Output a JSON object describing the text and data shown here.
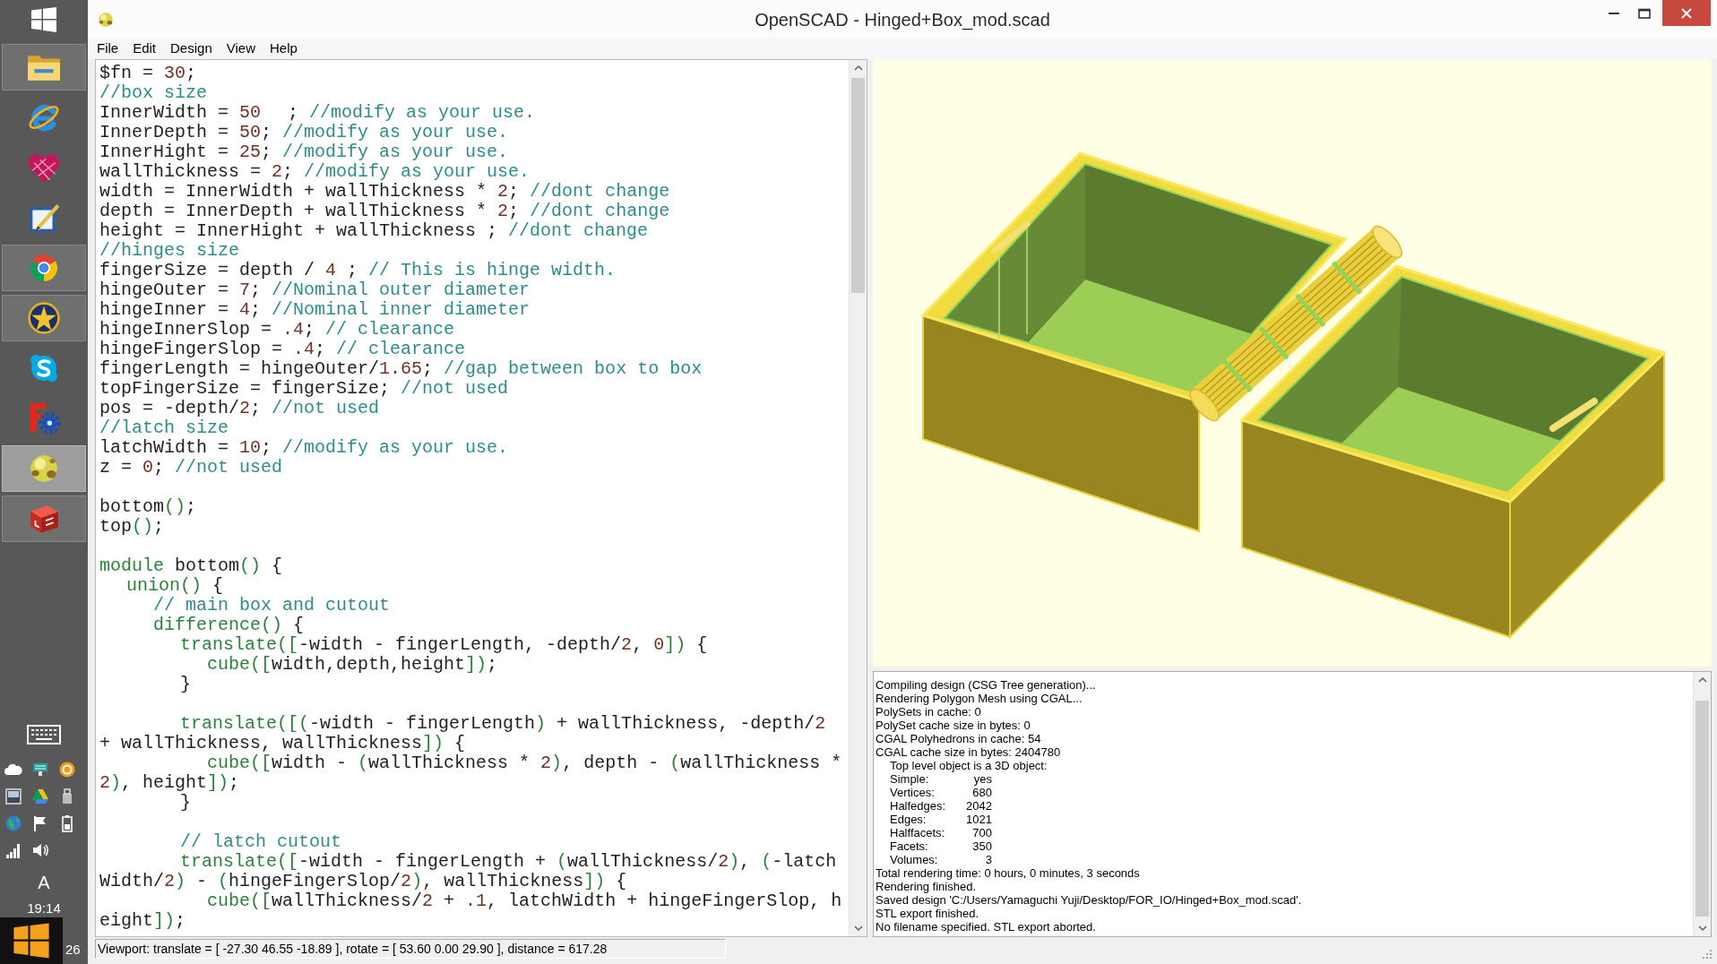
{
  "window": {
    "title": "OpenSCAD - Hinged+Box_mod.scad"
  },
  "menu": [
    "File",
    "Edit",
    "Design",
    "View",
    "Help"
  ],
  "editor": {
    "paragraphs": [
      {
        "lines": [
          {
            "tokens": [
              {
                "kind": "plain",
                "text": "$fn = "
              },
              {
                "kind": "number",
                "text": "30"
              },
              {
                "kind": "plain",
                "text": ";"
              }
            ]
          },
          {
            "tokens": [
              {
                "kind": "comment",
                "text": "//box size"
              }
            ]
          },
          {
            "tokens": [
              {
                "kind": "plain",
                "text": "InnerWidth = "
              },
              {
                "kind": "number",
                "text": "50"
              },
              {
                "kind": "plain",
                "text": "\t; "
              },
              {
                "kind": "comment",
                "text": "//modify as your use."
              }
            ]
          },
          {
            "tokens": [
              {
                "kind": "plain",
                "text": "InnerDepth = "
              },
              {
                "kind": "number",
                "text": "50"
              },
              {
                "kind": "plain",
                "text": "; "
              },
              {
                "kind": "comment",
                "text": "//modify as your use."
              }
            ]
          },
          {
            "tokens": [
              {
                "kind": "plain",
                "text": "InnerHight = "
              },
              {
                "kind": "number",
                "text": "25"
              },
              {
                "kind": "plain",
                "text": "; "
              },
              {
                "kind": "comment",
                "text": "//modify as your use."
              }
            ]
          },
          {
            "tokens": [
              {
                "kind": "plain",
                "text": "wallThickness = "
              },
              {
                "kind": "number",
                "text": "2"
              },
              {
                "kind": "plain",
                "text": "; "
              },
              {
                "kind": "comment",
                "text": "//modify as your use."
              }
            ]
          },
          {
            "tokens": [
              {
                "kind": "plain",
                "text": "width = InnerWidth + wallThickness * "
              },
              {
                "kind": "number",
                "text": "2"
              },
              {
                "kind": "plain",
                "text": "; "
              },
              {
                "kind": "comment",
                "text": "//dont change"
              }
            ]
          },
          {
            "tokens": [
              {
                "kind": "plain",
                "text": "depth = InnerDepth + wallThickness * "
              },
              {
                "kind": "number",
                "text": "2"
              },
              {
                "kind": "plain",
                "text": "; "
              },
              {
                "kind": "comment",
                "text": "//dont change"
              }
            ]
          },
          {
            "tokens": [
              {
                "kind": "plain",
                "text": "height = InnerHight + wallThickness ; "
              },
              {
                "kind": "comment",
                "text": "//dont change"
              }
            ]
          },
          {
            "tokens": [
              {
                "kind": "comment",
                "text": "//hinges size"
              }
            ]
          },
          {
            "tokens": [
              {
                "kind": "plain",
                "text": "fingerSize = depth / "
              },
              {
                "kind": "number",
                "text": "4"
              },
              {
                "kind": "plain",
                "text": " ; "
              },
              {
                "kind": "comment",
                "text": "// This is hinge width."
              }
            ]
          },
          {
            "tokens": [
              {
                "kind": "plain",
                "text": "hingeOuter = "
              },
              {
                "kind": "number",
                "text": "7"
              },
              {
                "kind": "plain",
                "text": "; "
              },
              {
                "kind": "comment",
                "text": "//Nominal outer diameter"
              }
            ]
          },
          {
            "tokens": [
              {
                "kind": "plain",
                "text": "hingeInner = "
              },
              {
                "kind": "number",
                "text": "4"
              },
              {
                "kind": "plain",
                "text": "; "
              },
              {
                "kind": "comment",
                "text": "//Nominal inner diameter"
              }
            ]
          },
          {
            "tokens": [
              {
                "kind": "plain",
                "text": "hingeInnerSlop = "
              },
              {
                "kind": "number",
                "text": ".4"
              },
              {
                "kind": "plain",
                "text": "; "
              },
              {
                "kind": "comment",
                "text": "// clearance"
              }
            ]
          },
          {
            "tokens": [
              {
                "kind": "plain",
                "text": "hingeFingerSlop = "
              },
              {
                "kind": "number",
                "text": ".4"
              },
              {
                "kind": "plain",
                "text": "; "
              },
              {
                "kind": "comment",
                "text": "// clearance"
              }
            ]
          },
          {
            "tokens": [
              {
                "kind": "plain",
                "text": "fingerLength = hingeOuter/"
              },
              {
                "kind": "number",
                "text": "1.65"
              },
              {
                "kind": "plain",
                "text": "; "
              },
              {
                "kind": "comment",
                "text": "//gap between box to box"
              }
            ]
          },
          {
            "tokens": [
              {
                "kind": "plain",
                "text": "topFingerSize = fingerSize; "
              },
              {
                "kind": "comment",
                "text": "//not used"
              }
            ]
          },
          {
            "tokens": [
              {
                "kind": "plain",
                "text": "pos = -depth/"
              },
              {
                "kind": "number",
                "text": "2"
              },
              {
                "kind": "plain",
                "text": "; "
              },
              {
                "kind": "comment",
                "text": "//not used"
              }
            ]
          },
          {
            "tokens": [
              {
                "kind": "comment",
                "text": "//latch size"
              }
            ]
          },
          {
            "tokens": [
              {
                "kind": "plain",
                "text": "latchWidth = "
              },
              {
                "kind": "number",
                "text": "10"
              },
              {
                "kind": "plain",
                "text": "; "
              },
              {
                "kind": "comment",
                "text": "//modify as your use."
              }
            ]
          },
          {
            "tokens": [
              {
                "kind": "plain",
                "text": "z = "
              },
              {
                "kind": "number",
                "text": "0"
              },
              {
                "kind": "plain",
                "text": "; "
              },
              {
                "kind": "comment",
                "text": "//not used"
              }
            ]
          }
        ]
      },
      {
        "lines": [
          {
            "tokens": [
              {
                "kind": "plain",
                "text": "bottom"
              },
              {
                "kind": "bracket",
                "text": "()"
              },
              {
                "kind": "plain",
                "text": ";"
              }
            ]
          },
          {
            "tokens": [
              {
                "kind": "plain",
                "text": "top"
              },
              {
                "kind": "bracket",
                "text": "()"
              },
              {
                "kind": "plain",
                "text": ";"
              }
            ]
          }
        ]
      },
      {
        "lines": [
          {
            "tokens": [
              {
                "kind": "keyword",
                "text": "module"
              },
              {
                "kind": "plain",
                "text": " bottom"
              },
              {
                "kind": "bracket",
                "text": "()"
              },
              {
                "kind": "plain",
                "text": " {"
              }
            ]
          },
          {
            "tokens": [
              {
                "kind": "keyword",
                "text": "\tunion"
              },
              {
                "kind": "bracket",
                "text": "()"
              },
              {
                "kind": "plain",
                "text": " {"
              }
            ]
          },
          {
            "tokens": [
              {
                "kind": "comment",
                "text": "\t\t// main box and cutout"
              }
            ]
          },
          {
            "tokens": [
              {
                "kind": "keyword",
                "text": "\t\tdifference"
              },
              {
                "kind": "bracket",
                "text": "()"
              },
              {
                "kind": "plain",
                "text": " {"
              }
            ]
          },
          {
            "tokens": [
              {
                "kind": "keyword",
                "text": "\t\t\ttranslate"
              },
              {
                "kind": "bracket",
                "text": "(["
              },
              {
                "kind": "plain",
                "text": "-width - fingerLength, -depth/"
              },
              {
                "kind": "number",
                "text": "2"
              },
              {
                "kind": "plain",
                "text": ", "
              },
              {
                "kind": "number",
                "text": "0"
              },
              {
                "kind": "bracket",
                "text": "])"
              },
              {
                "kind": "plain",
                "text": " {"
              }
            ]
          },
          {
            "tokens": [
              {
                "kind": "keyword",
                "text": "\t\t\t\tcube"
              },
              {
                "kind": "bracket",
                "text": "(["
              },
              {
                "kind": "plain",
                "text": "width,depth,height"
              },
              {
                "kind": "bracket",
                "text": "])"
              },
              {
                "kind": "plain",
                "text": ";"
              }
            ]
          },
          {
            "tokens": [
              {
                "kind": "plain",
                "text": "\t\t\t}"
              }
            ]
          }
        ]
      },
      {
        "lines": [
          {
            "tokens": [
              {
                "kind": "keyword",
                "text": "\t\t\ttranslate"
              },
              {
                "kind": "bracket",
                "text": "([("
              },
              {
                "kind": "plain",
                "text": "-width - fingerLength"
              },
              {
                "kind": "bracket",
                "text": ")"
              },
              {
                "kind": "plain",
                "text": " + wallThickness, -depth/"
              },
              {
                "kind": "number",
                "text": "2"
              },
              {
                "kind": "plain",
                "text": " + wallThickness, wallThickness"
              },
              {
                "kind": "bracket",
                "text": "])"
              },
              {
                "kind": "plain",
                "text": " {"
              }
            ]
          },
          {
            "tokens": [
              {
                "kind": "keyword",
                "text": "\t\t\t\tcube"
              },
              {
                "kind": "bracket",
                "text": "(["
              },
              {
                "kind": "plain",
                "text": "width - "
              },
              {
                "kind": "bracket",
                "text": "("
              },
              {
                "kind": "plain",
                "text": "wallThickness * "
              },
              {
                "kind": "number",
                "text": "2"
              },
              {
                "kind": "bracket",
                "text": ")"
              },
              {
                "kind": "plain",
                "text": ", depth - "
              },
              {
                "kind": "bracket",
                "text": "("
              },
              {
                "kind": "plain",
                "text": "wallThickness * "
              },
              {
                "kind": "number",
                "text": "2"
              },
              {
                "kind": "bracket",
                "text": ")"
              },
              {
                "kind": "plain",
                "text": ", height"
              },
              {
                "kind": "bracket",
                "text": "])"
              },
              {
                "kind": "plain",
                "text": ";"
              }
            ]
          },
          {
            "tokens": [
              {
                "kind": "plain",
                "text": "\t\t\t}"
              }
            ]
          }
        ]
      },
      {
        "lines": [
          {
            "tokens": [
              {
                "kind": "comment",
                "text": "\t\t\t// latch cutout"
              }
            ]
          },
          {
            "tokens": [
              {
                "kind": "keyword",
                "text": "\t\t\ttranslate"
              },
              {
                "kind": "bracket",
                "text": "(["
              },
              {
                "kind": "plain",
                "text": "-width - fingerLength + "
              },
              {
                "kind": "bracket",
                "text": "("
              },
              {
                "kind": "plain",
                "text": "wallThickness/"
              },
              {
                "kind": "number",
                "text": "2"
              },
              {
                "kind": "bracket",
                "text": ")"
              },
              {
                "kind": "plain",
                "text": ", "
              },
              {
                "kind": "bracket",
                "text": "("
              },
              {
                "kind": "plain",
                "text": "-latchWidth/"
              },
              {
                "kind": "number",
                "text": "2"
              },
              {
                "kind": "bracket",
                "text": ")"
              },
              {
                "kind": "plain",
                "text": " - "
              },
              {
                "kind": "bracket",
                "text": "("
              },
              {
                "kind": "plain",
                "text": "hingeFingerSlop/"
              },
              {
                "kind": "number",
                "text": "2"
              },
              {
                "kind": "bracket",
                "text": ")"
              },
              {
                "kind": "plain",
                "text": ", wallThickness"
              },
              {
                "kind": "bracket",
                "text": "])"
              },
              {
                "kind": "plain",
                "text": " {"
              }
            ]
          },
          {
            "tokens": [
              {
                "kind": "keyword",
                "text": "\t\t\t\tcube"
              },
              {
                "kind": "bracket",
                "text": "(["
              },
              {
                "kind": "plain",
                "text": "wallThickness/"
              },
              {
                "kind": "number",
                "text": "2"
              },
              {
                "kind": "plain",
                "text": " + "
              },
              {
                "kind": "number",
                "text": ".1"
              },
              {
                "kind": "plain",
                "text": ", latchWidth + hingeFingerSlop, height"
              },
              {
                "kind": "bracket",
                "text": "])"
              },
              {
                "kind": "plain",
                "text": ";"
              }
            ]
          }
        ]
      }
    ]
  },
  "console": {
    "lines": [
      {
        "kind": "message",
        "text": "Compiling design (CSG Tree generation)..."
      },
      {
        "kind": "message",
        "text": "Rendering Polygon Mesh using CGAL..."
      },
      {
        "kind": "message",
        "text": "PolySets in cache: 0"
      },
      {
        "kind": "message",
        "text": "PolySet cache size in bytes: 0"
      },
      {
        "kind": "message",
        "text": "CGAL Polyhedrons in cache: 54"
      },
      {
        "kind": "message",
        "text": "CGAL cache size in bytes: 2404780"
      },
      {
        "kind": "detail",
        "text": "Top level object is a 3D object:"
      },
      {
        "kind": "stat",
        "label": "Simple:",
        "value": "yes"
      },
      {
        "kind": "stat",
        "label": "Vertices:",
        "value": "680"
      },
      {
        "kind": "stat",
        "label": "Halfedges:",
        "value": "2042"
      },
      {
        "kind": "stat",
        "label": "Edges:",
        "value": "1021"
      },
      {
        "kind": "stat",
        "label": "Halffacets:",
        "value": "700"
      },
      {
        "kind": "stat",
        "label": "Facets:",
        "value": "350"
      },
      {
        "kind": "stat",
        "label": "Volumes:",
        "value": "3"
      },
      {
        "kind": "message",
        "text": "Total rendering time: 0 hours, 0 minutes, 3 seconds"
      },
      {
        "kind": "message",
        "text": "Rendering finished."
      },
      {
        "kind": "message",
        "text": "Saved design 'C:/Users/Yamaguchi Yuji/Desktop/FOR_IO/Hinged+Box_mod.scad'."
      },
      {
        "kind": "message",
        "text": "STL export finished."
      },
      {
        "kind": "message",
        "text": "No filename specified. STL export aborted."
      }
    ]
  },
  "status_bar": {
    "text": "Viewport: translate = [ -27.30 46.55 -18.89 ], rotate = [ 53.60 0.00 29.90 ], distance = 617.28"
  },
  "taskbar": {
    "apps": [
      {
        "kind": "folder",
        "running": true,
        "selected": false
      },
      {
        "kind": "globe",
        "running": false,
        "selected": false
      },
      {
        "kind": "heart",
        "running": false,
        "selected": false
      },
      {
        "kind": "pen",
        "running": false,
        "selected": false
      },
      {
        "kind": "wheel",
        "running": true,
        "selected": false
      },
      {
        "kind": "star",
        "running": true,
        "selected": false
      },
      {
        "kind": "chat",
        "running": false,
        "selected": false
      },
      {
        "kind": "gear",
        "running": false,
        "selected": false
      },
      {
        "kind": "sphere",
        "running": true,
        "selected": true
      },
      {
        "kind": "cube",
        "running": true,
        "selected": false
      }
    ],
    "input_mode": "A",
    "clock": "19:14",
    "bottom_label": "26"
  }
}
